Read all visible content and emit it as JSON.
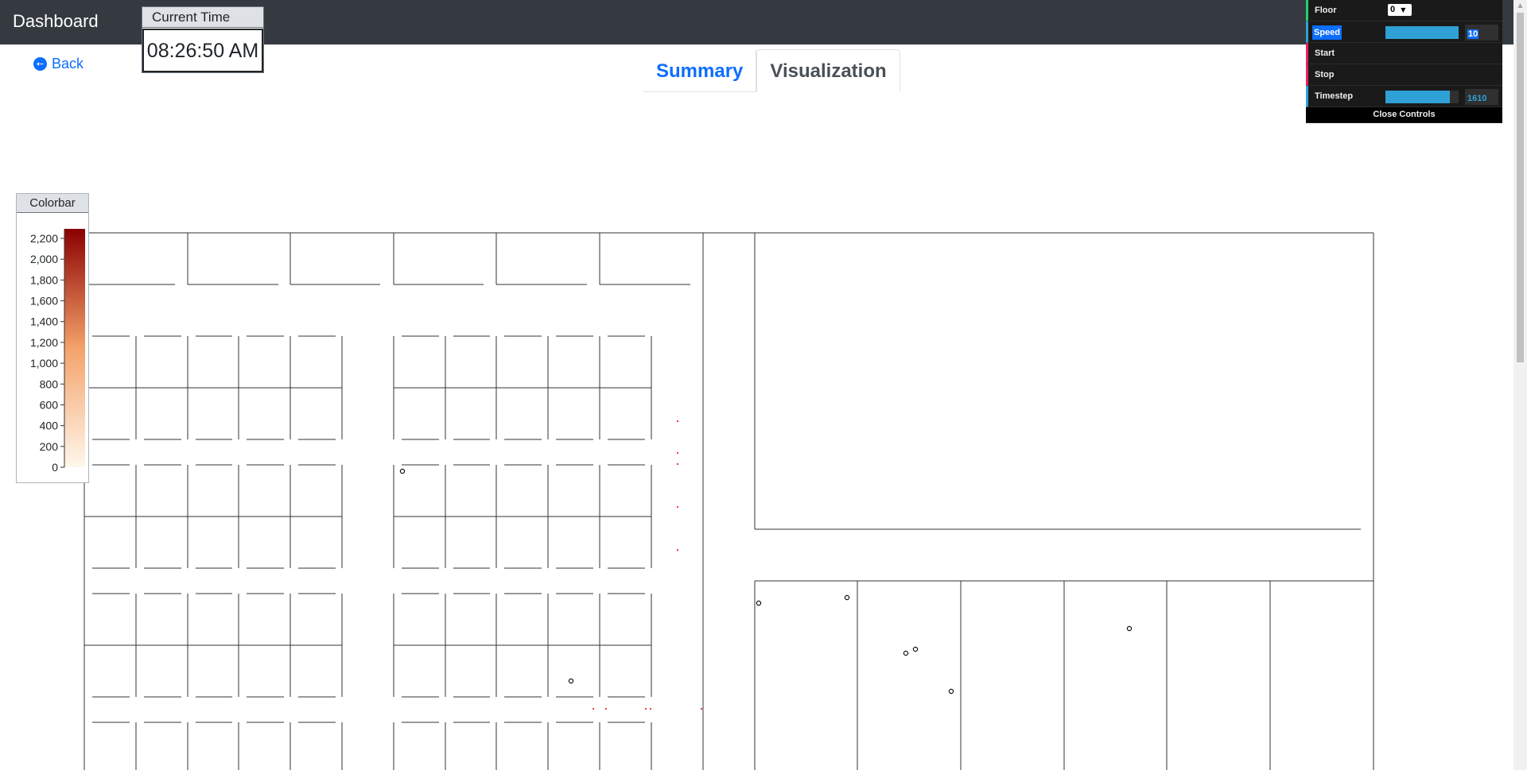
{
  "navbar": {
    "brand": "Dashboard"
  },
  "time": {
    "title": "Current Time",
    "value": "08:26:50 AM"
  },
  "back": {
    "label": "Back"
  },
  "tabs": [
    {
      "label": "Summary",
      "active": false
    },
    {
      "label": "Visualization",
      "active": true
    }
  ],
  "colorbar": {
    "title": "Colorbar",
    "ticks": [
      "2,200",
      "2,000",
      "1,800",
      "1,600",
      "1,400",
      "1,200",
      "1,000",
      "800",
      "600",
      "400",
      "200",
      "0"
    ],
    "color_high": "#8b0000",
    "color_mid": "#f4a26a",
    "color_low": "#fff7ec"
  },
  "controls": {
    "floor_label": "Floor",
    "floor_value": "0",
    "speed_label": "Speed",
    "speed_value": "10",
    "speed_fraction": 1.0,
    "start_label": "Start",
    "stop_label": "Stop",
    "timestep_label": "Timestep",
    "timestep_value": "1610",
    "timestep_fraction": 0.88,
    "close_label": "Close Controls"
  },
  "icons": {
    "back": "arrow-left-circle-icon",
    "dropdown": "chevron-down-icon"
  },
  "colors": {
    "navbar_bg": "#343a40",
    "link": "#0d6efd",
    "gui_accent": "#2fa1d6",
    "gui_function": "#e61d5f",
    "occupant_marker": "#e60000"
  }
}
